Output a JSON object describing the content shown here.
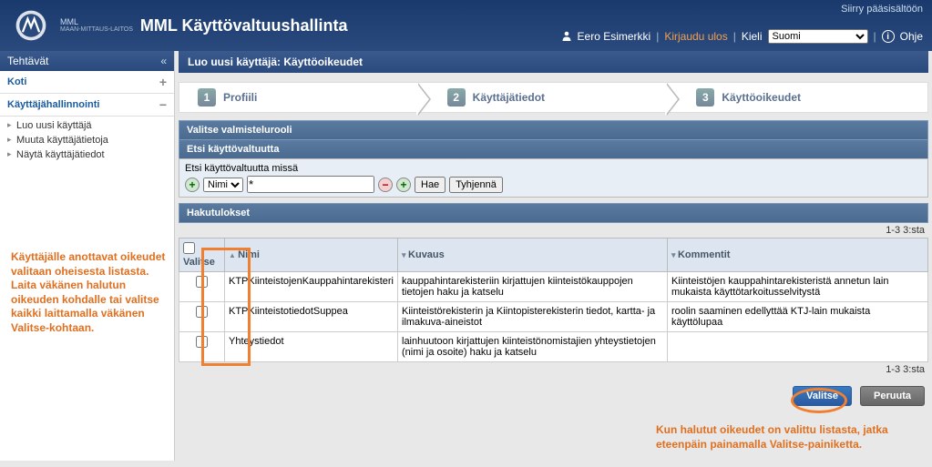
{
  "header": {
    "skip": "Siirry pääsisältöön",
    "logo_text": "MML",
    "logo_sub": "MAAN-MITTAUS-LAITOS",
    "title": "MML Käyttövaltuushallinta",
    "user": "Eero Esimerkki",
    "logout": "Kirjaudu ulos",
    "lang_label": "Kieli",
    "lang_value": "Suomi",
    "help": "Ohje"
  },
  "sidebar": {
    "title": "Tehtävät",
    "collapse": "«",
    "koti": "Koti",
    "admin": "Käyttäjähallinnointi",
    "items": [
      "Luo uusi käyttäjä",
      "Muuta käyttäjätietoja",
      "Näytä käyttäjätiedot"
    ]
  },
  "page": {
    "title": "Luo uusi käyttäjä: Käyttöoikeudet",
    "steps": [
      {
        "num": "1",
        "label": "Profiili"
      },
      {
        "num": "2",
        "label": "Käyttäjätiedot"
      },
      {
        "num": "3",
        "label": "Käyttöoikeudet"
      }
    ]
  },
  "sections": {
    "role": "Valitse valmistelurooli",
    "search": "Etsi käyttövaltuutta",
    "search_label": "Etsi käyttövaltuutta missä",
    "field_select": "Nimi",
    "pattern": "*",
    "hae": "Hae",
    "tyhjenna": "Tyhjennä",
    "results": "Hakutulokset"
  },
  "table": {
    "count": "1-3 3:sta",
    "cols": {
      "select": "Valitse",
      "nimi": "Nimi",
      "kuvaus": "Kuvaus",
      "kommentit": "Kommentit"
    },
    "rows": [
      {
        "nimi": "KTPKiinteistojenKauppahintarekisteri",
        "kuvaus": "kauppahintarekisteriin kirjattujen kiinteistökauppojen tietojen haku ja katselu",
        "kommentit": "Kiinteistöjen kauppahintarekisteristä annetun lain mukaista käyttötarkoitusselvitystä"
      },
      {
        "nimi": "KTPKiinteistotiedotSuppea",
        "kuvaus": "Kiinteistörekisterin ja Kiintopisterekisterin tiedot, kartta- ja ilmakuva-aineistot",
        "kommentit": "roolin saaminen edellyttää KTJ-lain mukaista käyttölupaa"
      },
      {
        "nimi": "Yhteystiedot",
        "kuvaus": "lainhuutoon kirjattujen kiinteistönomistajien yhteystietojen (nimi ja osoite) haku ja katselu",
        "kommentit": ""
      }
    ]
  },
  "buttons": {
    "valitse": "Valitse",
    "peruuta": "Peruuta"
  },
  "annotations": {
    "left": "Käyttäjälle anottavat oikeudet valitaan oheisesta listasta. Laita väkänen halutun oikeuden kohdalle tai valitse kaikki laittamalla väkänen Valitse-kohtaan.",
    "right": "Kun halutut oikeudet on valittu listasta, jatka eteenpäin painamalla Valitse-painiketta."
  }
}
